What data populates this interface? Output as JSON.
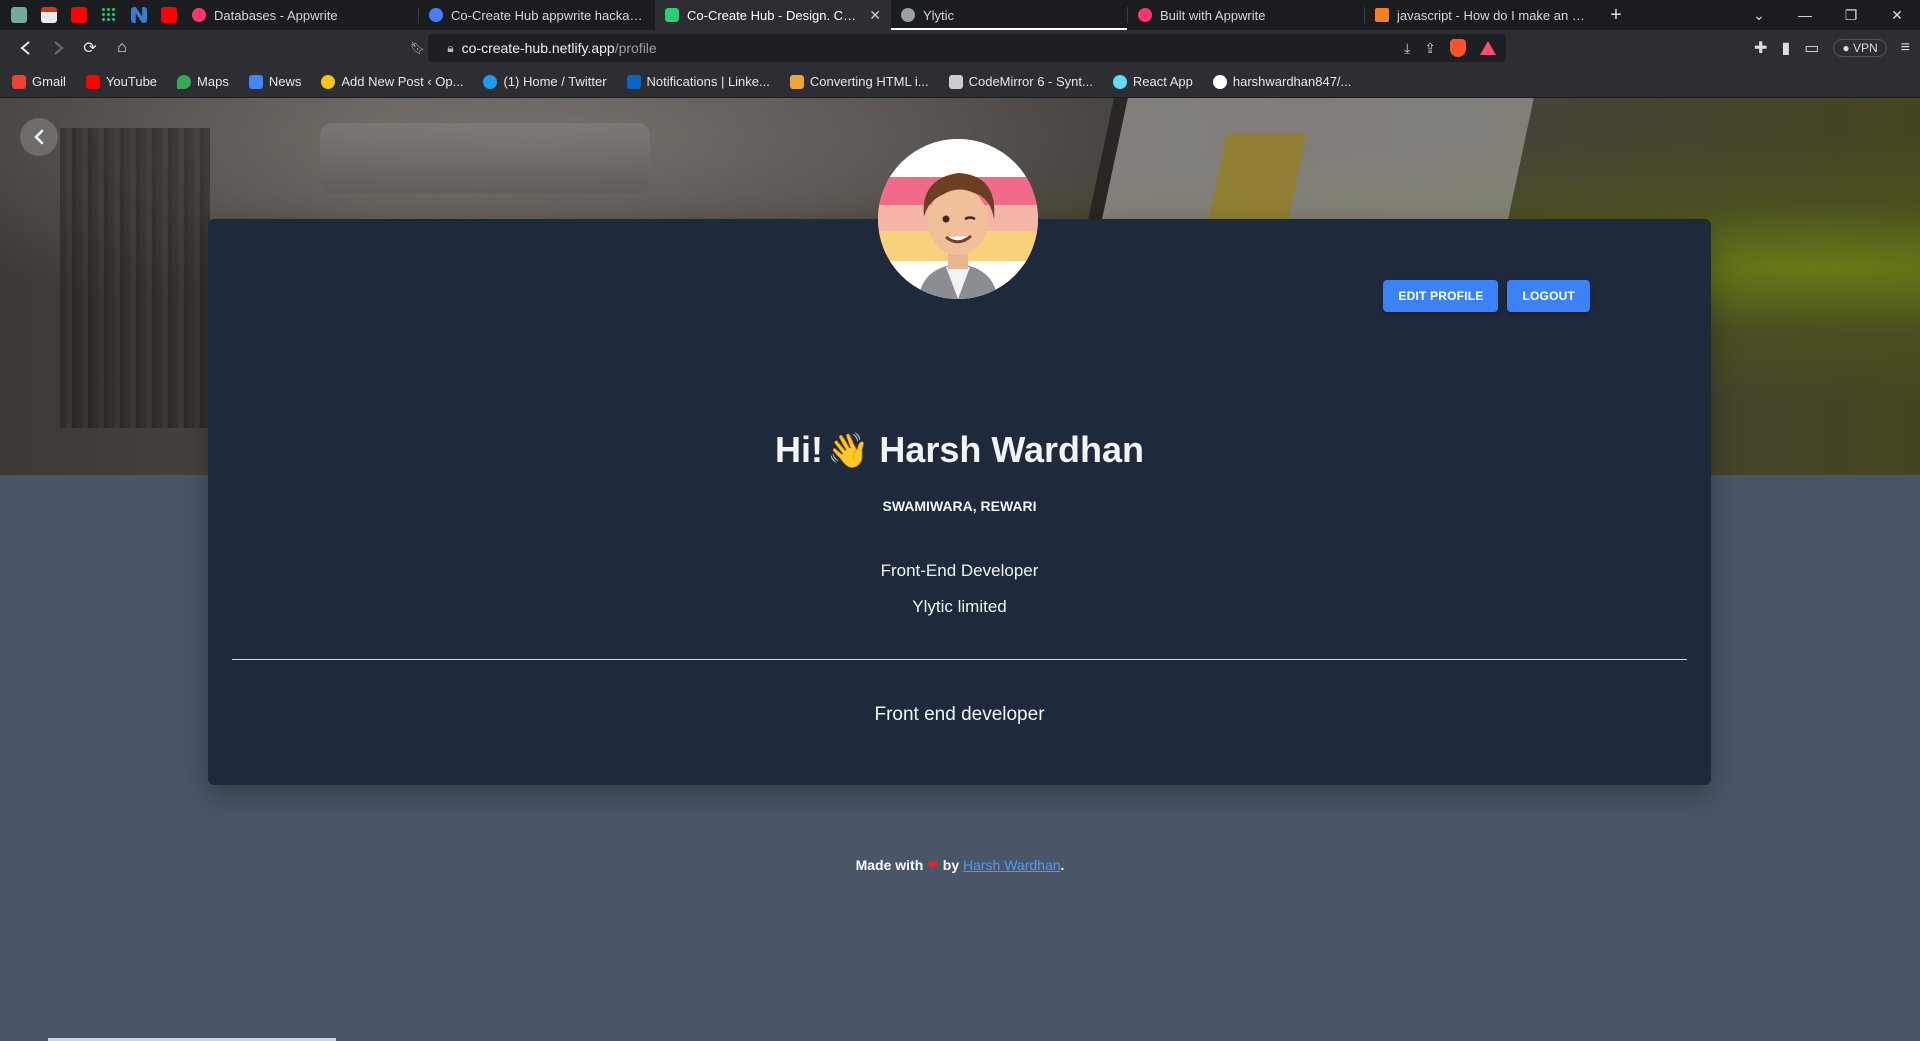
{
  "browser": {
    "tabs": [
      {
        "label": "Databases - Appwrite",
        "color": "#fd366e"
      },
      {
        "label": "Co-Create Hub appwrite hackathon p",
        "color": "#4a7cff"
      },
      {
        "label": "Co-Create Hub - Design. Code. C",
        "color": "#2ecc71",
        "active": true
      },
      {
        "label": "Ylytic",
        "color": "#9aa0a6"
      },
      {
        "label": "Built with Appwrite",
        "color": "#fd366e"
      },
      {
        "label": "javascript - How do I make an array w",
        "color": "#f48024"
      }
    ],
    "url_host": "co-create-hub.netlify.app",
    "url_path": "/profile",
    "vpn_label": "VPN",
    "bookmarks": [
      {
        "label": "Gmail",
        "color": "#ea4335"
      },
      {
        "label": "YouTube",
        "color": "#ff0000"
      },
      {
        "label": "Maps",
        "color": "#34a853"
      },
      {
        "label": "News",
        "color": "#4285f4"
      },
      {
        "label": "Add New Post ‹ Op...",
        "color": "#f5c518"
      },
      {
        "label": "(1) Home / Twitter",
        "color": "#1d9bf0"
      },
      {
        "label": "Notifications | Linke...",
        "color": "#0a66c2"
      },
      {
        "label": "Converting HTML i...",
        "color": "#f1a33b"
      },
      {
        "label": "CodeMirror 6 - Synt...",
        "color": "#cccccc"
      },
      {
        "label": "React App",
        "color": "#61dafb"
      },
      {
        "label": "harshwardhan847/...",
        "color": "#ffffff"
      }
    ]
  },
  "profile": {
    "greeting_prefix": "Hi!",
    "wave_emoji": "👋",
    "name": "Harsh Wardhan",
    "location": "SWAMIWARA, REWARI",
    "role": "Front-End Developer",
    "company": "Ylytic limited",
    "bio": "Front end developer",
    "edit_label": "EDIT PROFILE",
    "logout_label": "LOGOUT"
  },
  "footer": {
    "made_with": "Made with",
    "heart": "❤",
    "by": "by",
    "author": "Harsh Wardhan",
    "period": "."
  },
  "colors": {
    "card": "#1e293b",
    "page": "#4a5568",
    "button": "#3b82f6"
  }
}
